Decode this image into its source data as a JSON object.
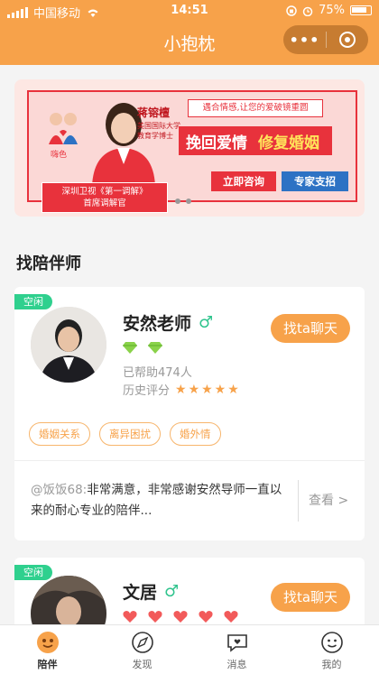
{
  "status": {
    "carrier": "中国移动",
    "time": "14:51",
    "battery": "75%"
  },
  "nav": {
    "title": "小抱枕",
    "more_label": "•••"
  },
  "banner": {
    "mascot_text": "嗨色",
    "host_name": "蒋镕檀",
    "host_line1": "美国国际大学",
    "host_line2": "教育学博士",
    "slogan": "遇合情感,让您的爱破镜重圆",
    "big_slogan_1": "挽回爱情",
    "big_slogan_2": "修复婚姻",
    "consult_label": "立即咨询",
    "expert_label": "专家支招",
    "tv_line1": "深圳卫视《第一调解》",
    "tv_line2": "首席调解官",
    "colors": {
      "red": "#e8323c",
      "blue": "#2d72c4",
      "yellow": "#ffe45a"
    }
  },
  "section": {
    "title": "找陪伴师"
  },
  "counselors": [
    {
      "status": "空闲",
      "name": "安然老师",
      "gender": "♂",
      "helped": "已帮助474人",
      "rating_label": "历史评分",
      "stars": "★★★★★",
      "rating": 5,
      "chat_label": "找ta聊天",
      "tags": [
        "婚姻关系",
        "离异困扰",
        "婚外情"
      ],
      "review_user": "@饭饭68:",
      "review_text": "非常满意，非常感谢安然导师一直以来的耐心专业的陪伴...",
      "more_label": "查看 >"
    },
    {
      "status": "空闲",
      "name": "文居",
      "gender": "♂",
      "chat_label": "找ta聊天"
    }
  ],
  "tabbar": {
    "items": [
      {
        "label": "陪伴",
        "icon": "companion-icon"
      },
      {
        "label": "发现",
        "icon": "discover-icon"
      },
      {
        "label": "消息",
        "icon": "message-icon"
      },
      {
        "label": "我的",
        "icon": "profile-icon"
      }
    ]
  },
  "colors": {
    "accent": "#f7a24a",
    "idle": "#2fd08e",
    "gender": "#2fc48d"
  }
}
